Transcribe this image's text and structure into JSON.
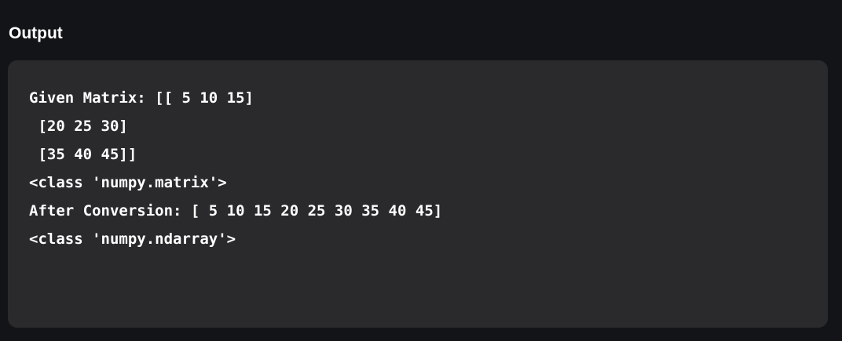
{
  "heading": "Output",
  "output": {
    "lines": [
      "Given Matrix: [[ 5 10 15]",
      " [20 25 30]",
      " [35 40 45]]",
      "<class 'numpy.matrix'>",
      "After Conversion: [ 5 10 15 20 25 30 35 40 45]",
      "<class 'numpy.ndarray'>"
    ]
  }
}
